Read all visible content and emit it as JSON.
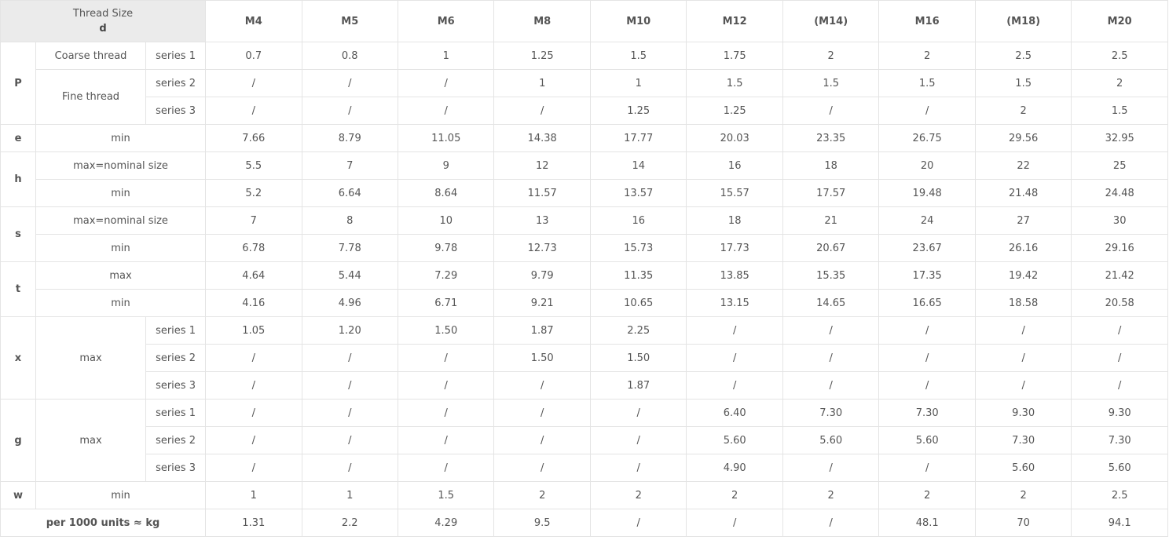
{
  "header": {
    "thread_size": "Thread Size",
    "d": "d",
    "sizes": [
      "M4",
      "M5",
      "M6",
      "M8",
      "M10",
      "M12",
      "(M14)",
      "M16",
      "(M18)",
      "M20"
    ]
  },
  "labels": {
    "P": "P",
    "e": "e",
    "h": "h",
    "s": "s",
    "t": "t",
    "x": "x",
    "g": "g",
    "w": "w",
    "coarse": "Coarse thread",
    "fine": "Fine thread",
    "series1": "series 1",
    "series2": "series 2",
    "series3": "series 3",
    "min": "min",
    "max": "max",
    "max_nominal": "max=nominal size",
    "weight": "per 1000 units ≈ kg"
  },
  "rows": {
    "p_s1": [
      "0.7",
      "0.8",
      "1",
      "1.25",
      "1.5",
      "1.75",
      "2",
      "2",
      "2.5",
      "2.5"
    ],
    "p_s2": [
      "/",
      "/",
      "/",
      "1",
      "1",
      "1.5",
      "1.5",
      "1.5",
      "1.5",
      "2"
    ],
    "p_s3": [
      "/",
      "/",
      "/",
      "/",
      "1.25",
      "1.25",
      "/",
      "/",
      "2",
      "1.5"
    ],
    "e_min": [
      "7.66",
      "8.79",
      "11.05",
      "14.38",
      "17.77",
      "20.03",
      "23.35",
      "26.75",
      "29.56",
      "32.95"
    ],
    "h_max": [
      "5.5",
      "7",
      "9",
      "12",
      "14",
      "16",
      "18",
      "20",
      "22",
      "25"
    ],
    "h_min": [
      "5.2",
      "6.64",
      "8.64",
      "11.57",
      "13.57",
      "15.57",
      "17.57",
      "19.48",
      "21.48",
      "24.48"
    ],
    "s_max": [
      "7",
      "8",
      "10",
      "13",
      "16",
      "18",
      "21",
      "24",
      "27",
      "30"
    ],
    "s_min": [
      "6.78",
      "7.78",
      "9.78",
      "12.73",
      "15.73",
      "17.73",
      "20.67",
      "23.67",
      "26.16",
      "29.16"
    ],
    "t_max": [
      "4.64",
      "5.44",
      "7.29",
      "9.79",
      "11.35",
      "13.85",
      "15.35",
      "17.35",
      "19.42",
      "21.42"
    ],
    "t_min": [
      "4.16",
      "4.96",
      "6.71",
      "9.21",
      "10.65",
      "13.15",
      "14.65",
      "16.65",
      "18.58",
      "20.58"
    ],
    "x_s1": [
      "1.05",
      "1.20",
      "1.50",
      "1.87",
      "2.25",
      "/",
      "/",
      "/",
      "/",
      "/"
    ],
    "x_s2": [
      "/",
      "/",
      "/",
      "1.50",
      "1.50",
      "/",
      "/",
      "/",
      "/",
      "/"
    ],
    "x_s3": [
      "/",
      "/",
      "/",
      "/",
      "1.87",
      "/",
      "/",
      "/",
      "/",
      "/"
    ],
    "g_s1": [
      "/",
      "/",
      "/",
      "/",
      "/",
      "6.40",
      "7.30",
      "7.30",
      "9.30",
      "9.30"
    ],
    "g_s2": [
      "/",
      "/",
      "/",
      "/",
      "/",
      "5.60",
      "5.60",
      "5.60",
      "7.30",
      "7.30"
    ],
    "g_s3": [
      "/",
      "/",
      "/",
      "/",
      "/",
      "4.90",
      "/",
      "/",
      "5.60",
      "5.60"
    ],
    "w_min": [
      "1",
      "1",
      "1.5",
      "2",
      "2",
      "2",
      "2",
      "2",
      "2",
      "2.5"
    ],
    "weight": [
      "1.31",
      "2.2",
      "4.29",
      "9.5",
      "/",
      "/",
      "/",
      "48.1",
      "70",
      "94.1"
    ]
  }
}
